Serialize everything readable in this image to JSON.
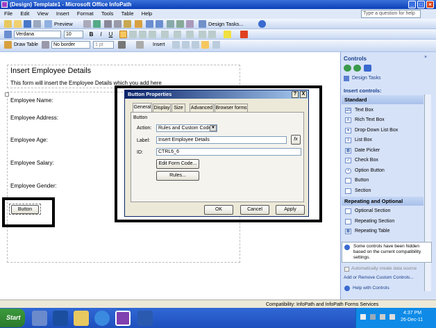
{
  "window": {
    "title": "(Design) Template1 - Microsoft Office InfoPath"
  },
  "menu": [
    "File",
    "Edit",
    "View",
    "Insert",
    "Format",
    "Tools",
    "Table",
    "Help"
  ],
  "help_search": {
    "placeholder": "Type a question for help"
  },
  "toolbar1": {
    "preview_label": "Preview",
    "design_tasks_label": "Design Tasks..."
  },
  "toolbar2": {
    "font": "Verdana",
    "size": "10"
  },
  "toolbar3": {
    "draw_table_label": "Draw Table",
    "border_value": "No border",
    "border_width": "1 pt",
    "insert_label": "Insert"
  },
  "form": {
    "title": "Insert Employee Details",
    "subtitle": "This form will insert the Employee Details which you add here",
    "fields": [
      "Employee Name:",
      "Employee Address:",
      "Employee Age:",
      "Employee Salary:",
      "Employee Gender:"
    ],
    "button_label": "Button"
  },
  "dialog": {
    "title": "Button Properties",
    "help": "?",
    "close": "X",
    "tabs": [
      "General",
      "Display",
      "Size",
      "Advanced",
      "Browser forms"
    ],
    "section": "Button",
    "action_label": "Action:",
    "action_value": "Rules and Custom Code",
    "label_label": "Label:",
    "label_value": "Insert Employee Details",
    "fx": "fx",
    "id_label": "ID:",
    "id_value": "CTRL6_6",
    "edit_code_button": "Edit Form Code...",
    "rules_button": "Rules...",
    "ok": "OK",
    "cancel": "Cancel",
    "apply": "Apply"
  },
  "taskpane": {
    "title": "Controls",
    "design_tasks": "Design Tasks",
    "insert_controls": "Insert controls:",
    "standard": "Standard",
    "standard_items": [
      "Text Box",
      "Rich Text Box",
      "Drop-Down List Box",
      "List Box",
      "Date Picker",
      "Check Box",
      "Option Button",
      "Button",
      "Section"
    ],
    "repeating": "Repeating and Optional",
    "repeating_items": [
      "Optional Section",
      "Repeating Section",
      "Repeating Table"
    ],
    "notice": "Some controls have been hidden based on the current compatibility settings.",
    "auto_create": "Automatically create data source",
    "add_remove": "Add or Remove Custom Controls...",
    "help_link": "Help with Controls"
  },
  "status": {
    "compatibility": "Compatibility: InfoPath and InfoPath Forms Services"
  },
  "taskbar": {
    "start": "Start",
    "time": "4:37 PM",
    "date": "26-Dec-11"
  },
  "colors": {
    "title_blue": "#0a3fb8",
    "highlight_border": "#000000",
    "taskbar_blue": "#245edb"
  }
}
